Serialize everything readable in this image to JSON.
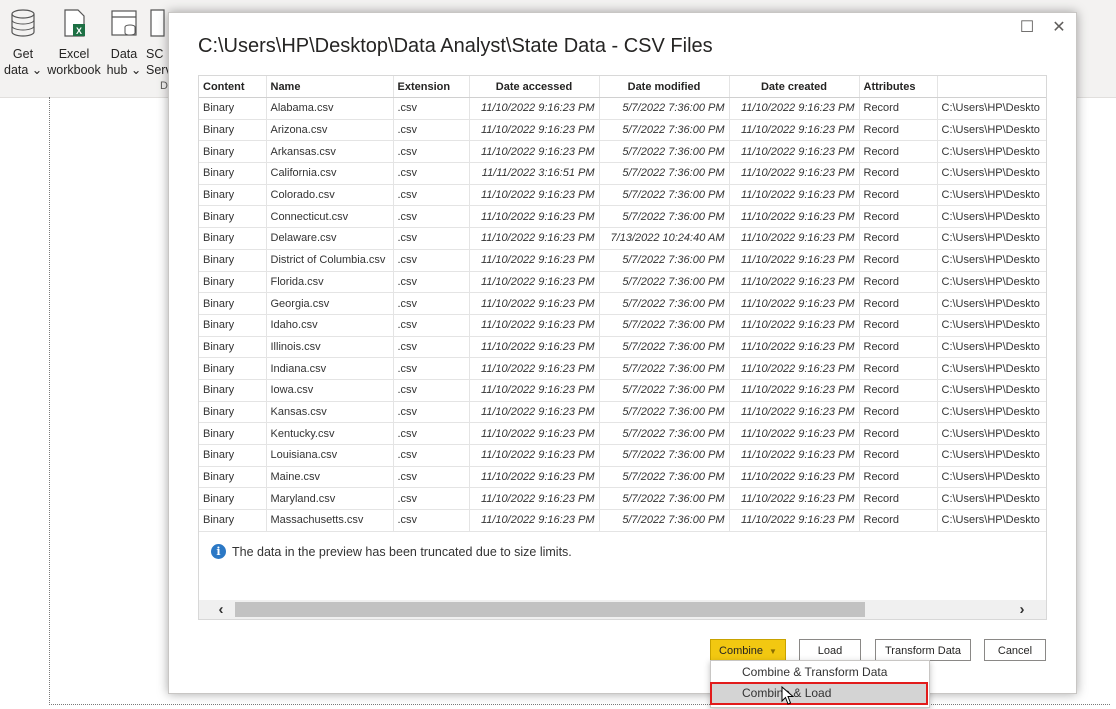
{
  "ribbon": {
    "items": [
      {
        "line1": "Get",
        "line2": "data ⌄"
      },
      {
        "line1": "Excel",
        "line2": "workbook"
      },
      {
        "line1": "Data",
        "line2": "hub ⌄"
      },
      {
        "line1": "SC",
        "line2": "Serv"
      }
    ],
    "group_label": "D"
  },
  "dialog": {
    "title": "C:\\Users\\HP\\Desktop\\Data Analyst\\State Data - CSV Files",
    "columns": [
      "Content",
      "Name",
      "Extension",
      "Date accessed",
      "Date modified",
      "Date created",
      "Attributes",
      ""
    ],
    "rows": [
      [
        "Binary",
        "Alabama.csv",
        ".csv",
        "11/10/2022 9:16:23 PM",
        "5/7/2022 7:36:00 PM",
        "11/10/2022 9:16:23 PM",
        "Record",
        "C:\\Users\\HP\\Deskto"
      ],
      [
        "Binary",
        "Arizona.csv",
        ".csv",
        "11/10/2022 9:16:23 PM",
        "5/7/2022 7:36:00 PM",
        "11/10/2022 9:16:23 PM",
        "Record",
        "C:\\Users\\HP\\Deskto"
      ],
      [
        "Binary",
        "Arkansas.csv",
        ".csv",
        "11/10/2022 9:16:23 PM",
        "5/7/2022 7:36:00 PM",
        "11/10/2022 9:16:23 PM",
        "Record",
        "C:\\Users\\HP\\Deskto"
      ],
      [
        "Binary",
        "California.csv",
        ".csv",
        "11/11/2022 3:16:51 PM",
        "5/7/2022 7:36:00 PM",
        "11/10/2022 9:16:23 PM",
        "Record",
        "C:\\Users\\HP\\Deskto"
      ],
      [
        "Binary",
        "Colorado.csv",
        ".csv",
        "11/10/2022 9:16:23 PM",
        "5/7/2022 7:36:00 PM",
        "11/10/2022 9:16:23 PM",
        "Record",
        "C:\\Users\\HP\\Deskto"
      ],
      [
        "Binary",
        "Connecticut.csv",
        ".csv",
        "11/10/2022 9:16:23 PM",
        "5/7/2022 7:36:00 PM",
        "11/10/2022 9:16:23 PM",
        "Record",
        "C:\\Users\\HP\\Deskto"
      ],
      [
        "Binary",
        "Delaware.csv",
        ".csv",
        "11/10/2022 9:16:23 PM",
        "7/13/2022 10:24:40 AM",
        "11/10/2022 9:16:23 PM",
        "Record",
        "C:\\Users\\HP\\Deskto"
      ],
      [
        "Binary",
        "District of Columbia.csv",
        ".csv",
        "11/10/2022 9:16:23 PM",
        "5/7/2022 7:36:00 PM",
        "11/10/2022 9:16:23 PM",
        "Record",
        "C:\\Users\\HP\\Deskto"
      ],
      [
        "Binary",
        "Florida.csv",
        ".csv",
        "11/10/2022 9:16:23 PM",
        "5/7/2022 7:36:00 PM",
        "11/10/2022 9:16:23 PM",
        "Record",
        "C:\\Users\\HP\\Deskto"
      ],
      [
        "Binary",
        "Georgia.csv",
        ".csv",
        "11/10/2022 9:16:23 PM",
        "5/7/2022 7:36:00 PM",
        "11/10/2022 9:16:23 PM",
        "Record",
        "C:\\Users\\HP\\Deskto"
      ],
      [
        "Binary",
        "Idaho.csv",
        ".csv",
        "11/10/2022 9:16:23 PM",
        "5/7/2022 7:36:00 PM",
        "11/10/2022 9:16:23 PM",
        "Record",
        "C:\\Users\\HP\\Deskto"
      ],
      [
        "Binary",
        "Illinois.csv",
        ".csv",
        "11/10/2022 9:16:23 PM",
        "5/7/2022 7:36:00 PM",
        "11/10/2022 9:16:23 PM",
        "Record",
        "C:\\Users\\HP\\Deskto"
      ],
      [
        "Binary",
        "Indiana.csv",
        ".csv",
        "11/10/2022 9:16:23 PM",
        "5/7/2022 7:36:00 PM",
        "11/10/2022 9:16:23 PM",
        "Record",
        "C:\\Users\\HP\\Deskto"
      ],
      [
        "Binary",
        "Iowa.csv",
        ".csv",
        "11/10/2022 9:16:23 PM",
        "5/7/2022 7:36:00 PM",
        "11/10/2022 9:16:23 PM",
        "Record",
        "C:\\Users\\HP\\Deskto"
      ],
      [
        "Binary",
        "Kansas.csv",
        ".csv",
        "11/10/2022 9:16:23 PM",
        "5/7/2022 7:36:00 PM",
        "11/10/2022 9:16:23 PM",
        "Record",
        "C:\\Users\\HP\\Deskto"
      ],
      [
        "Binary",
        "Kentucky.csv",
        ".csv",
        "11/10/2022 9:16:23 PM",
        "5/7/2022 7:36:00 PM",
        "11/10/2022 9:16:23 PM",
        "Record",
        "C:\\Users\\HP\\Deskto"
      ],
      [
        "Binary",
        "Louisiana.csv",
        ".csv",
        "11/10/2022 9:16:23 PM",
        "5/7/2022 7:36:00 PM",
        "11/10/2022 9:16:23 PM",
        "Record",
        "C:\\Users\\HP\\Deskto"
      ],
      [
        "Binary",
        "Maine.csv",
        ".csv",
        "11/10/2022 9:16:23 PM",
        "5/7/2022 7:36:00 PM",
        "11/10/2022 9:16:23 PM",
        "Record",
        "C:\\Users\\HP\\Deskto"
      ],
      [
        "Binary",
        "Maryland.csv",
        ".csv",
        "11/10/2022 9:16:23 PM",
        "5/7/2022 7:36:00 PM",
        "11/10/2022 9:16:23 PM",
        "Record",
        "C:\\Users\\HP\\Deskto"
      ],
      [
        "Binary",
        "Massachusetts.csv",
        ".csv",
        "11/10/2022 9:16:23 PM",
        "5/7/2022 7:36:00 PM",
        "11/10/2022 9:16:23 PM",
        "Record",
        "C:\\Users\\HP\\Deskto"
      ]
    ],
    "notice": "The data in the preview has been truncated due to size limits.",
    "buttons": {
      "combine": "Combine",
      "load": "Load",
      "transform": "Transform Data",
      "cancel": "Cancel"
    },
    "combine_menu": {
      "items": [
        "Combine & Transform Data",
        "Combine & Load"
      ],
      "highlighted_index": 1
    }
  },
  "colors": {
    "accent": "#f2c811",
    "highlight_outline": "#e21b1b",
    "info_icon": "#2b78c5"
  }
}
